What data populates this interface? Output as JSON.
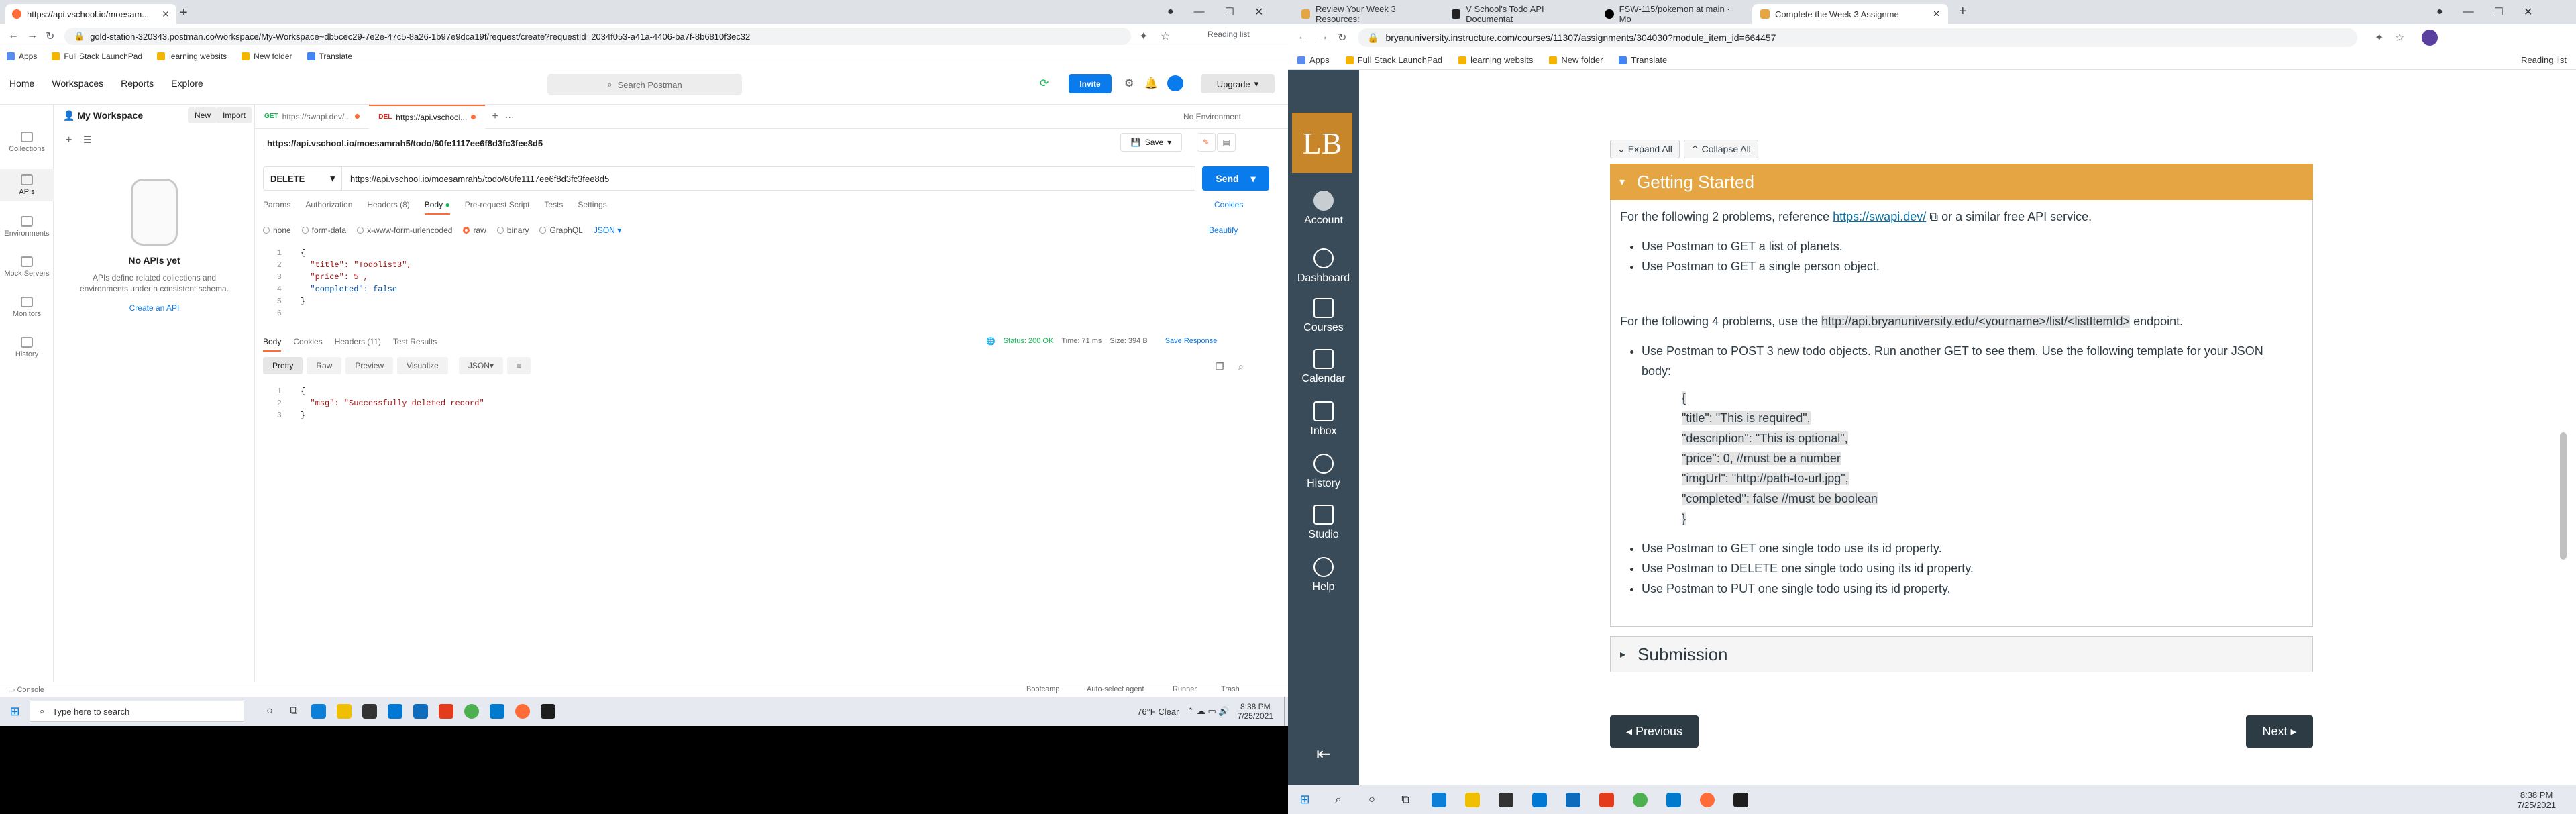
{
  "left_browser": {
    "tab_title": "https://api.vschool.io/moesam...",
    "url": "gold-station-320343.postman.co/workspace/My-Workspace~db5cec29-7e2e-47c5-8a26-1b97e9dca19f/request/create?requestId=2034f053-a41a-4406-ba7f-8b6810f3ec32",
    "reading_list": "Reading list",
    "bookmarks": [
      "Apps",
      "Full Stack LaunchPad",
      "learning websits",
      "New folder",
      "Translate"
    ]
  },
  "postman": {
    "nav": [
      "Home",
      "Workspaces",
      "Reports",
      "Explore"
    ],
    "search_placeholder": "Search Postman",
    "invite_label": "Invite",
    "upgrade_label": "Upgrade",
    "rail": [
      "Collections",
      "APIs",
      "Environments",
      "Mock Servers",
      "Monitors",
      "History"
    ],
    "workspace_title": "My Workspace",
    "new_label": "New",
    "import_label": "Import",
    "no_apis_title": "No APIs yet",
    "no_apis_text": "APIs define related collections and environments under a consistent schema.",
    "create_api": "Create an API",
    "req_tabs": [
      {
        "method": "GET",
        "label": "https://swapi.dev/..."
      },
      {
        "method": "DEL",
        "label": "https://api.vschool..."
      }
    ],
    "environment": "No Environment",
    "request_title": "https://api.vschool.io/moesamrah5/todo/60fe1117ee6f8d3fc3fee8d5",
    "save_label": "Save",
    "method": "DELETE",
    "url": "https://api.vschool.io/moesamrah5/todo/60fe1117ee6f8d3fc3fee8d5",
    "send_label": "Send",
    "subtabs": [
      "Params",
      "Authorization",
      "Headers (8)",
      "Body",
      "Pre-request Script",
      "Tests",
      "Settings"
    ],
    "cookies_label": "Cookies",
    "body_types": [
      "none",
      "form-data",
      "x-www-form-urlencoded",
      "raw",
      "binary",
      "GraphQL"
    ],
    "body_format": "JSON",
    "beautify_label": "Beautify",
    "code_lines": [
      "{",
      "  \"title\": \"Todolist3\",",
      "  \"price\": 5 ,",
      "  \"completed\": false",
      "}",
      ""
    ],
    "resp_tabs": [
      "Body",
      "Cookies",
      "Headers (11)",
      "Test Results"
    ],
    "status_text": "Status: 200 OK",
    "time_text": "Time: 71 ms",
    "size_text": "Size: 394 B",
    "save_response": "Save Response",
    "resp_formats": [
      "Pretty",
      "Raw",
      "Preview",
      "Visualize"
    ],
    "resp_format_sel": "JSON",
    "resp_lines": [
      "{",
      "  \"msg\": \"Successfully deleted record\"",
      "}"
    ],
    "console_label": "Console",
    "footer_items": [
      "Bootcamp",
      "Auto-select agent",
      "Runner",
      "Trash"
    ]
  },
  "left_taskbar": {
    "search_placeholder": "Type here to search",
    "weather": "76°F  Clear",
    "time": "8:38 PM",
    "date": "7/25/2021"
  },
  "right_browser": {
    "tabs": [
      "Review Your Week 3 Resources:",
      "V School's Todo API Documentat",
      "FSW-115/pokemon at main · Mo",
      "Complete the Week 3 Assignme"
    ],
    "url": "bryanuniversity.instructure.com/courses/11307/assignments/304030?module_item_id=664457",
    "reading_list": "Reading list",
    "bookmarks": [
      "Apps",
      "Full Stack LaunchPad",
      "learning websits",
      "New folder",
      "Translate"
    ]
  },
  "canvas": {
    "logo_text": "LB",
    "nav": [
      "Account",
      "Dashboard",
      "Courses",
      "Calendar",
      "Inbox",
      "History",
      "Studio",
      "Help"
    ],
    "expand_all": "Expand All",
    "collapse_all": "Collapse All",
    "section_title": "Getting Started",
    "p1_pre": "For the following 2 problems, reference ",
    "p1_link": "https://swapi.dev/",
    "p1_post": " or a similar free API service.",
    "list1": [
      "Use Postman to GET a list of planets.",
      "Use Postman to GET a single person object."
    ],
    "p2_pre": "For the following 4 problems, use the ",
    "p2_code": "http://api.bryanuniversity.edu/<yourname>/list/<listItemId>",
    "p2_post": " endpoint.",
    "list2_intro": "Use Postman to POST 3 new todo objects. Run another GET to see them. Use the following template for your JSON body:",
    "json_lines": [
      "{",
      "\"title\": \"This is required\",",
      "\"description\": \"This is optional\",",
      "\"price\": 0, //must be a number",
      "\"imgUrl\": \"http://path-to-url.jpg\",",
      "\"completed\": false //must be boolean",
      "}"
    ],
    "list3": [
      "Use Postman to GET one single todo use its id property.",
      "Use Postman to DELETE one single todo using its id property.",
      "Use Postman to PUT one single todo using its id property."
    ],
    "submission_title": "Submission",
    "previous_label": "◂ Previous",
    "next_label": "Next ▸"
  },
  "right_taskbar": {
    "time": "8:38 PM",
    "date": "7/25/2021"
  }
}
